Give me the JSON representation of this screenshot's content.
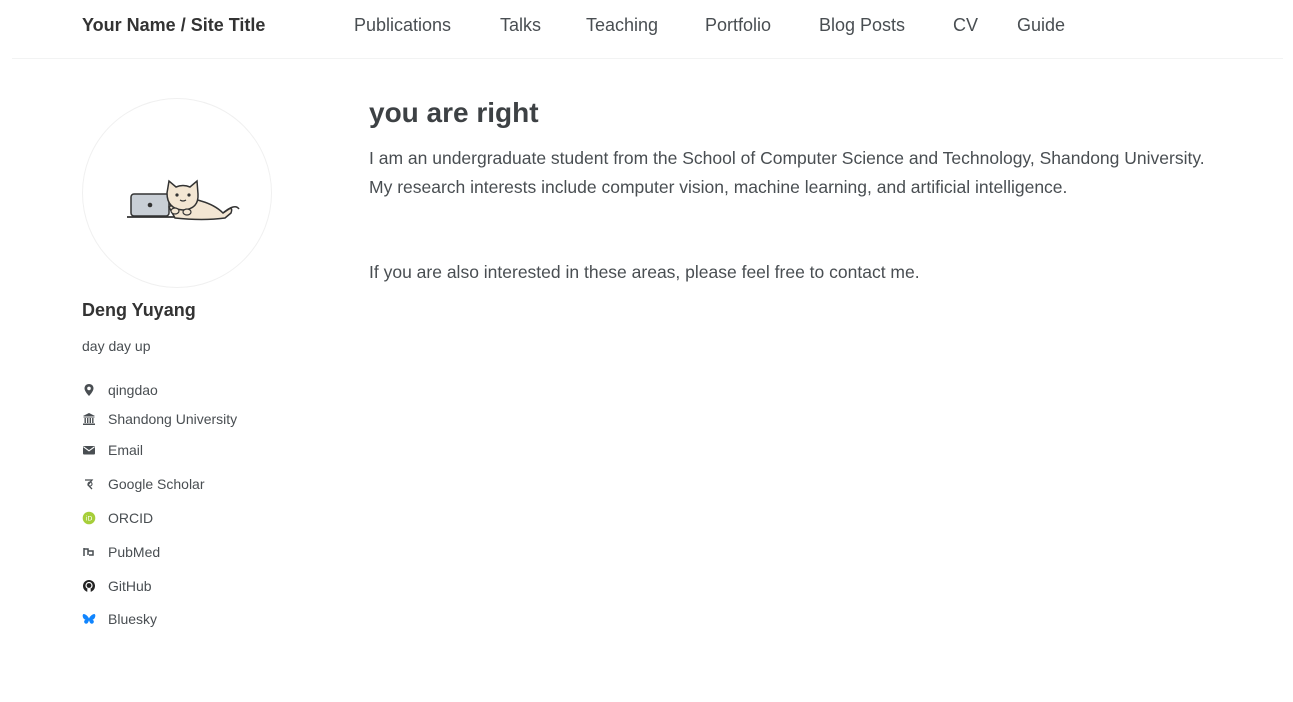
{
  "header": {
    "site_title": "Your Name / Site Title",
    "nav": [
      "Publications",
      "Talks",
      "Teaching",
      "Portfolio",
      "Blog Posts",
      "CV",
      "Guide"
    ]
  },
  "sidebar": {
    "name": "Deng Yuyang",
    "bio": "day day up",
    "links": [
      {
        "label": "qingdao",
        "icon": "map-marker-icon",
        "color": "#494e52"
      },
      {
        "label": "Shandong University",
        "icon": "university-icon",
        "color": "#494e52"
      },
      {
        "label": "Email",
        "icon": "envelope-icon",
        "color": "#494e52"
      },
      {
        "label": "Google Scholar",
        "icon": "graduation-cap-icon",
        "color": "#494e52"
      },
      {
        "label": "ORCID",
        "icon": "orcid-icon",
        "color": "#a6ce39"
      },
      {
        "label": "PubMed",
        "icon": "pubmed-icon",
        "color": "#494e52"
      },
      {
        "label": "GitHub",
        "icon": "github-icon",
        "color": "#222222"
      },
      {
        "label": "Bluesky",
        "icon": "bluesky-butterfly-icon",
        "color": "#1185fe"
      }
    ]
  },
  "main": {
    "title": "you are right",
    "paragraphs": [
      "I am an undergraduate student from the School of Computer Science and Technology, Shandong University. My research interests include computer vision, machine learning, and artificial intelligence.",
      "If you are also interested in these areas, please feel free to contact me."
    ]
  }
}
